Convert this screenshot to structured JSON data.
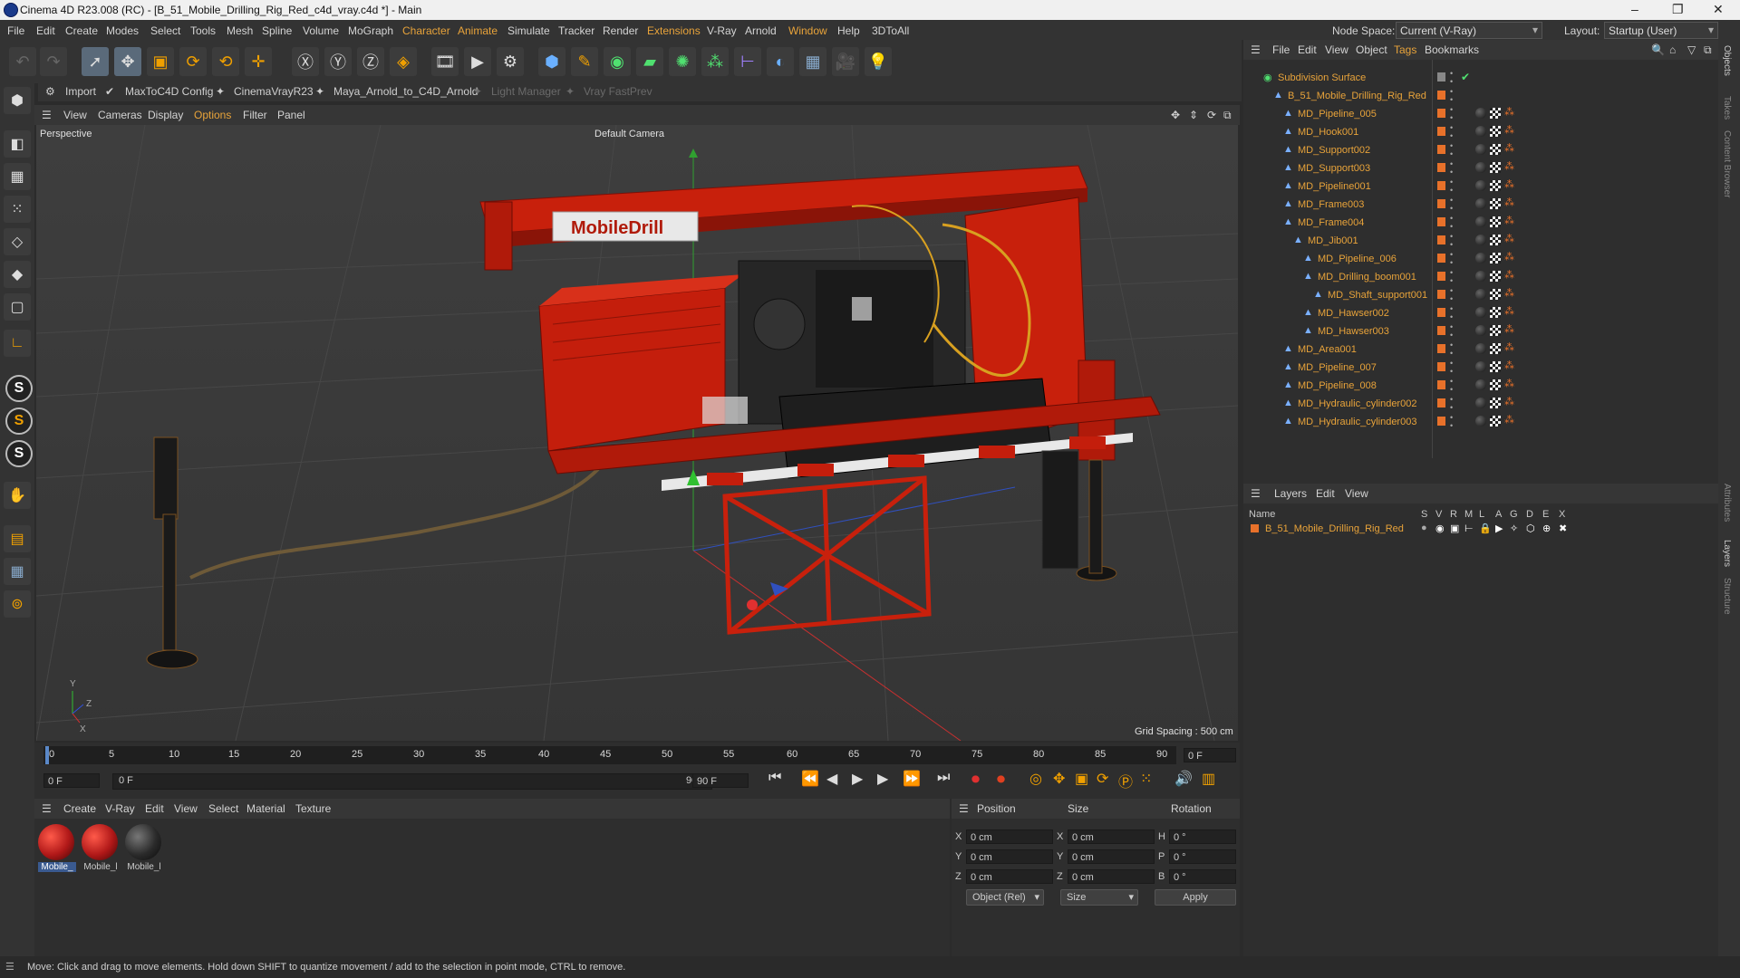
{
  "window": {
    "title": "Cinema 4D R23.008 (RC) - [B_51_Mobile_Drilling_Rig_Red_c4d_vray.c4d *] - Main",
    "controls": [
      "–",
      "❐",
      "✕"
    ]
  },
  "menubar": {
    "items": [
      "File",
      "Edit",
      "Create",
      "Modes",
      "Select",
      "Tools",
      "Mesh",
      "Spline",
      "Volume",
      "MoGraph",
      "Character",
      "Animate",
      "Simulate",
      "Tracker",
      "Render",
      "Extensions",
      "V-Ray",
      "Arnold",
      "Window",
      "Help",
      "3DToAll"
    ],
    "node_space_label": "Node Space:",
    "node_space_value": "Current (V-Ray)",
    "layout_label": "Layout:",
    "layout_value": "Startup (User)"
  },
  "pluginbar": {
    "items": [
      "Import",
      "MaxToC4D Config",
      "CinemaVrayR23",
      "Maya_Arnold_to_C4D_Arnold",
      "Light Manager",
      "Vray FastPrev"
    ]
  },
  "viewport": {
    "menu": [
      "View",
      "Cameras",
      "Display",
      "Options",
      "Filter",
      "Panel"
    ],
    "label": "Perspective",
    "camera": "Default Camera",
    "grid_spacing": "Grid Spacing : 500 cm",
    "sign_text": "MobileDrill"
  },
  "timeline": {
    "ticks": [
      "0",
      "5",
      "10",
      "15",
      "20",
      "25",
      "30",
      "35",
      "40",
      "45",
      "50",
      "55",
      "60",
      "65",
      "70",
      "75",
      "80",
      "85",
      "90"
    ],
    "end_field": "0 F",
    "start_frame": "0 F",
    "current_frame": "0 F",
    "end_frame": "90 F",
    "end_frame2": "90 F"
  },
  "material_manager": {
    "menu": [
      "Create",
      "V-Ray",
      "Edit",
      "View",
      "Select",
      "Material",
      "Texture"
    ],
    "materials": [
      {
        "label": "Mobile_",
        "color": "#b01818"
      },
      {
        "label": "Mobile_l",
        "color": "#b01818"
      },
      {
        "label": "Mobile_l",
        "color": "#2a2a2a"
      }
    ]
  },
  "coordinates": {
    "headers": [
      "Position",
      "Size",
      "Rotation"
    ],
    "rows": [
      {
        "a": "X",
        "pos": "0 cm",
        "b": "X",
        "size": "0 cm",
        "c": "H",
        "rot": "0 °"
      },
      {
        "a": "Y",
        "pos": "0 cm",
        "b": "Y",
        "size": "0 cm",
        "c": "P",
        "rot": "0 °"
      },
      {
        "a": "Z",
        "pos": "0 cm",
        "b": "Z",
        "size": "0 cm",
        "c": "B",
        "rot": "0 °"
      }
    ],
    "mode": "Object (Rel)",
    "size_mode": "Size",
    "apply": "Apply"
  },
  "object_manager": {
    "menu": [
      "File",
      "Edit",
      "View",
      "Object",
      "Tags",
      "Bookmarks"
    ],
    "objects": [
      {
        "name": "Subdivision Surface",
        "indent": 0,
        "root": true
      },
      {
        "name": "B_51_Mobile_Drilling_Rig_Red",
        "indent": 1
      },
      {
        "name": "MD_Pipeline_005",
        "indent": 2
      },
      {
        "name": "MD_Hook001",
        "indent": 2
      },
      {
        "name": "MD_Support002",
        "indent": 2
      },
      {
        "name": "MD_Support003",
        "indent": 2
      },
      {
        "name": "MD_Pipeline001",
        "indent": 2
      },
      {
        "name": "MD_Frame003",
        "indent": 2
      },
      {
        "name": "MD_Frame004",
        "indent": 2
      },
      {
        "name": "MD_Jib001",
        "indent": 3
      },
      {
        "name": "MD_Pipeline_006",
        "indent": 4
      },
      {
        "name": "MD_Drilling_boom001",
        "indent": 4
      },
      {
        "name": "MD_Shaft_support001",
        "indent": 5
      },
      {
        "name": "MD_Hawser002",
        "indent": 4
      },
      {
        "name": "MD_Hawser003",
        "indent": 4
      },
      {
        "name": "MD_Area001",
        "indent": 2
      },
      {
        "name": "MD_Pipeline_007",
        "indent": 2
      },
      {
        "name": "MD_Pipeline_008",
        "indent": 2
      },
      {
        "name": "MD_Hydraulic_cylinder002",
        "indent": 2
      },
      {
        "name": "MD_Hydraulic_cylinder003",
        "indent": 2
      }
    ]
  },
  "layer_manager": {
    "menu": [
      "Layers",
      "Edit",
      "View"
    ],
    "name_header": "Name",
    "flags": [
      "S",
      "V",
      "R",
      "M",
      "L",
      "A",
      "G",
      "D",
      "E",
      "X"
    ],
    "layers": [
      {
        "name": "B_51_Mobile_Drilling_Rig_Red"
      }
    ]
  },
  "right_tabs": [
    "Objects",
    "Takes",
    "Content Browser",
    "Attributes",
    "Layers",
    "Structure"
  ],
  "status": {
    "text": "Move: Click and drag to move elements. Hold down SHIFT to quantize movement / add to the selection in point mode, CTRL to remove."
  },
  "colors": {
    "accent": "#e8a33a",
    "rig_red": "#c8200c",
    "panel": "#2e2e2e"
  }
}
